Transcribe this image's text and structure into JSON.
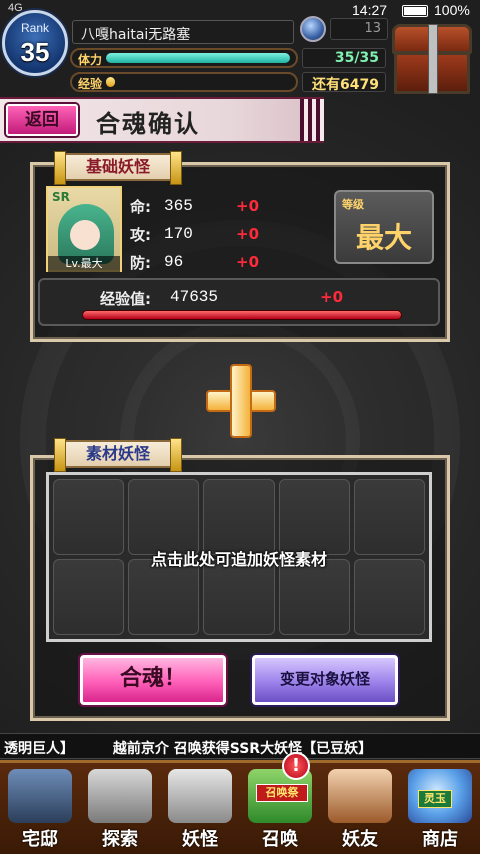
{
  "status_bar": {
    "signal": "4G",
    "time": "14:27",
    "battery": "100%"
  },
  "player": {
    "rank_label": "Rank",
    "rank_value": "35",
    "name": "八嘎haitai无路塞",
    "orb_value": "13",
    "stamina_label": "体力",
    "stamina_value": "35/35",
    "stamina_fraction": 1.0,
    "exp_label": "经验",
    "exp_value": "还有6479",
    "exp_fraction": 0.05
  },
  "header": {
    "back_label": "返回",
    "title": "合魂确认"
  },
  "base_yokai": {
    "tag": "基础妖怪",
    "badge": "SR",
    "level_text": "Lv.最大",
    "stats": [
      {
        "label": "命:",
        "value": "365",
        "delta": "+0"
      },
      {
        "label": "攻:",
        "value": "170",
        "delta": "+0"
      },
      {
        "label": "防:",
        "value": "96",
        "delta": "+0"
      }
    ],
    "level_box_label": "等级",
    "level_box_value": "最大",
    "exp_label": "经验值:",
    "exp_value": "47635",
    "exp_delta": "+0"
  },
  "material": {
    "tag": "素材妖怪",
    "hint": "点击此处可追加妖怪素材"
  },
  "actions": {
    "fuse_label": "合魂！",
    "change_label": "变更对象妖怪"
  },
  "ticker": {
    "items": [
      "透明巨人】",
      "越前京介 召唤获得SSR大妖怪【已豆妖】"
    ]
  },
  "nav": {
    "items": [
      {
        "label": "宅邸"
      },
      {
        "label": "探索"
      },
      {
        "label": "妖怪"
      },
      {
        "label": "召唤",
        "tag": "召唤祭",
        "alert": "!"
      },
      {
        "label": "妖友"
      },
      {
        "label": "商店",
        "tag": "灵玉"
      }
    ]
  },
  "colors": {
    "accent_pink": "#ff5fb8",
    "accent_purple": "#9c82ea",
    "stat_delta": "#ff2a3a",
    "gold": "#ffd36a"
  }
}
